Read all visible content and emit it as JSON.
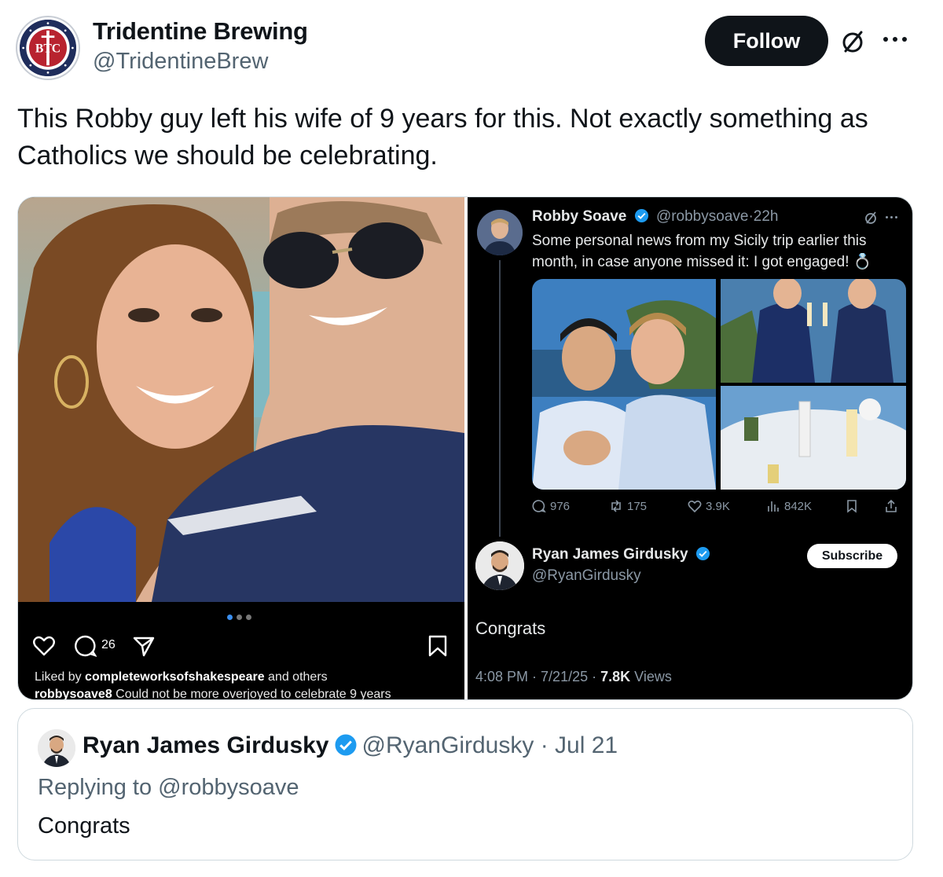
{
  "post": {
    "author_name": "Tridentine Brewing",
    "author_handle": "@TridentineBrew",
    "logo_text": "BTC",
    "follow_label": "Follow",
    "text": "This Robby guy left his wife of 9 years for this. Not exactly something as Catholics we should be celebrating."
  },
  "media": {
    "instagram": {
      "comment_count": "26",
      "liked_prefix": "Liked by ",
      "liked_user": "completeworksofshakespeare",
      "liked_suffix": " and others",
      "caption_user": "robbysoave8",
      "caption_text": " Could not be more overjoyed to celebrate 9 years"
    },
    "x_screenshot": {
      "post": {
        "name": "Robby Soave",
        "handle": "@robbysoave",
        "sep": "·",
        "age": "22h",
        "text": "Some personal news from my Sicily trip earlier this month, in case anyone missed it: I got engaged! 💍",
        "stats": {
          "replies": "976",
          "reposts": "175",
          "likes": "3.9K",
          "views": "842K"
        }
      },
      "reply": {
        "name": "Ryan James Girdusky",
        "handle": "@RyanGirdusky",
        "subscribe_label": "Subscribe",
        "text": "Congrats",
        "time": "4:08 PM",
        "date": "7/21/25",
        "views_count": "7.8K",
        "views_label": " Views",
        "sep": " · "
      }
    }
  },
  "quote": {
    "name": "Ryan James Girdusky",
    "handle": "@RyanGirdusky",
    "date": "· Jul 21",
    "replying_to": "Replying to @robbysoave",
    "text": "Congrats"
  },
  "colors": {
    "text": "#0f1419",
    "muted": "#536471",
    "verified": "#1d9bf0",
    "follow_bg": "#0f1419"
  }
}
